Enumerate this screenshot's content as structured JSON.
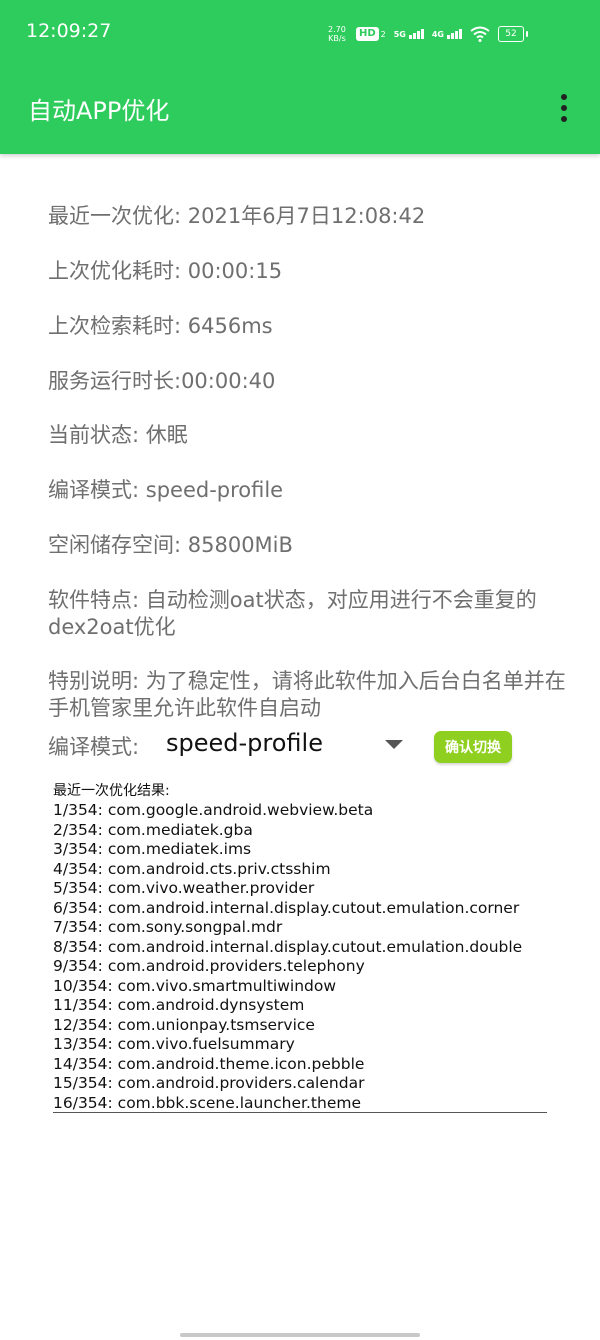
{
  "status_bar": {
    "time": "12:09:27",
    "net_speed_value": "2.70",
    "net_speed_unit": "KB/s",
    "hd_label": "HD",
    "hd_sub": "2",
    "net1": "5G",
    "net2": "4G",
    "battery": "52"
  },
  "app_bar": {
    "title": "自动APP优化",
    "menu_icon": "more-vert-icon"
  },
  "info": {
    "last_opt": "最近一次优化: 2021年6月7日12:08:42",
    "last_opt_duration": "上次优化耗时: 00:00:15",
    "last_search_duration": "上次检索耗时: 6456ms",
    "service_uptime": "服务运行时长:00:00:40",
    "current_state": "当前状态: 休眠",
    "compile_mode": "编译模式: speed-profile",
    "free_storage": "空闲储存空间: 85800MiB",
    "features": "软件特点: 自动检测oat状态，对应用进行不会重复的dex2oat优化",
    "note": "特别说明: 为了稳定性，请将此软件加入后台白名单并在手机管家里允许此软件自启动"
  },
  "mode_select": {
    "label": "编译模式:",
    "selected": "speed-profile",
    "confirm_label": "确认切换"
  },
  "results": {
    "title": "最近一次优化结果:",
    "items": [
      "1/354: com.google.android.webview.beta",
      "2/354: com.mediatek.gba",
      "3/354: com.mediatek.ims",
      "4/354: com.android.cts.priv.ctsshim",
      "5/354: com.vivo.weather.provider",
      "6/354: com.android.internal.display.cutout.emulation.corner",
      "7/354: com.sony.songpal.mdr",
      "8/354: com.android.internal.display.cutout.emulation.double",
      "9/354: com.android.providers.telephony",
      "10/354: com.vivo.smartmultiwindow",
      "11/354: com.android.dynsystem",
      "12/354: com.unionpay.tsmservice",
      "13/354: com.vivo.fuelsummary",
      "14/354: com.android.theme.icon.pebble",
      "15/354: com.android.providers.calendar",
      "16/354: com.bbk.scene.launcher.theme"
    ]
  }
}
